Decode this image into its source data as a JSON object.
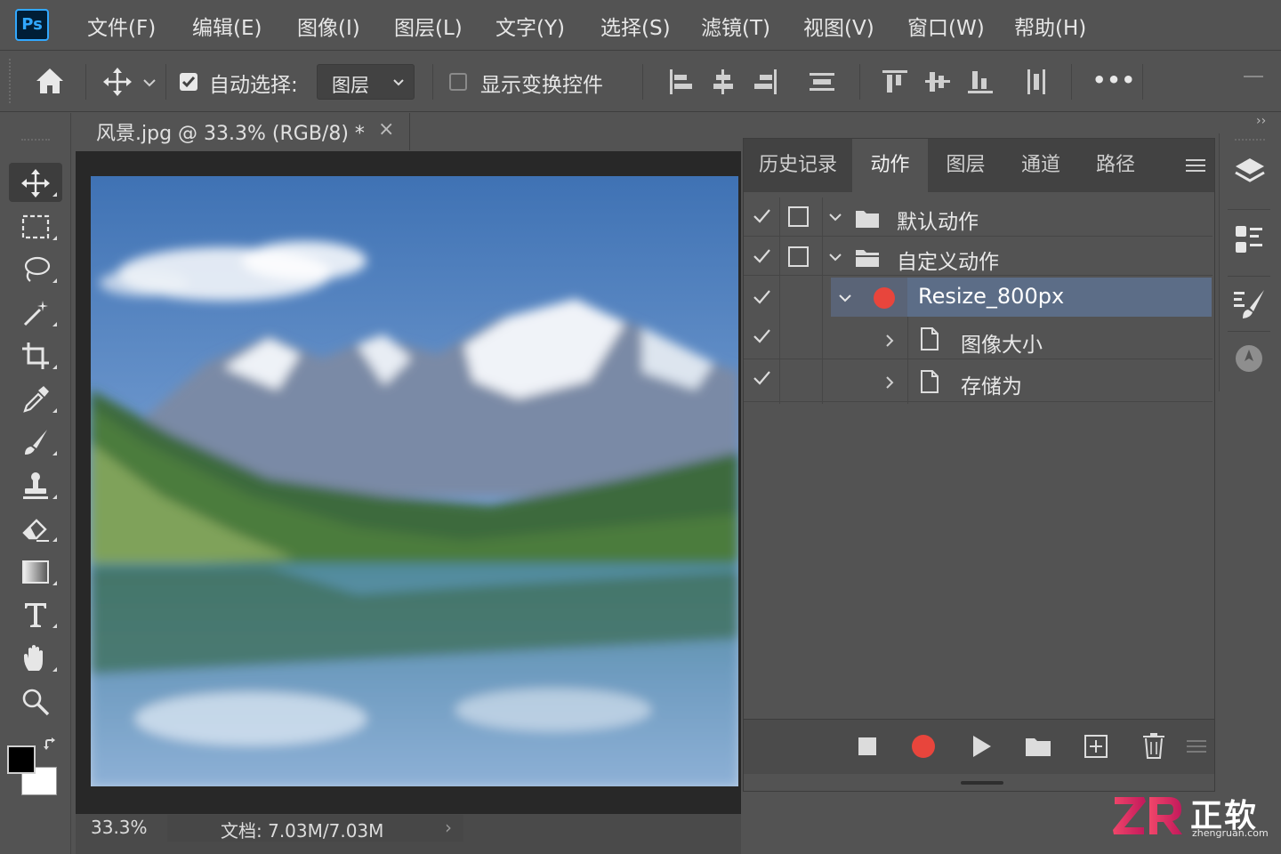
{
  "app": {
    "logo_text": "Ps"
  },
  "menu": [
    {
      "label": "文件(F)"
    },
    {
      "label": "编辑(E)"
    },
    {
      "label": "图像(I)"
    },
    {
      "label": "图层(L)"
    },
    {
      "label": "文字(Y)"
    },
    {
      "label": "选择(S)"
    },
    {
      "label": "滤镜(T)"
    },
    {
      "label": "视图(V)"
    },
    {
      "label": "窗口(W)"
    },
    {
      "label": "帮助(H)"
    }
  ],
  "options": {
    "auto_select_checked": true,
    "auto_select_label": "自动选择:",
    "auto_select_value": "图层",
    "show_transform_checked": false,
    "show_transform_label": "显示变换控件",
    "more_label": "•••"
  },
  "document": {
    "tab_title": "风景.jpg @ 33.3% (RGB/8) *",
    "close_glyph": "×",
    "zoom": "33.3%",
    "doc_info": "文档: 7.03M/7.03M",
    "info_chevron": "›"
  },
  "panel": {
    "tabs": [
      {
        "label": "历史记录",
        "active": false
      },
      {
        "label": "动作",
        "active": true
      },
      {
        "label": "图层",
        "active": false
      },
      {
        "label": "通道",
        "active": false
      },
      {
        "label": "路径",
        "active": false
      }
    ],
    "actions": [
      {
        "label": "默认动作",
        "checked": true,
        "type": "set",
        "expanded": true
      },
      {
        "label": "自定义动作",
        "checked": true,
        "type": "set",
        "expanded": true
      },
      {
        "label": "Resize_800px",
        "checked": true,
        "type": "action",
        "recording": true,
        "selected": true
      },
      {
        "label": "图像大小",
        "checked": true,
        "type": "step"
      },
      {
        "label": "存储为",
        "checked": true,
        "type": "step"
      }
    ],
    "record_color": "#e8453c"
  },
  "watermark": {
    "text": "正软",
    "url": "zhengruan.com",
    "brand_colors": [
      "#e8354a",
      "#c2185b"
    ]
  },
  "collapse": {
    "left": "‹‹",
    "right": "››"
  },
  "colors": {
    "foreground": "#000000",
    "background": "#ffffff"
  }
}
